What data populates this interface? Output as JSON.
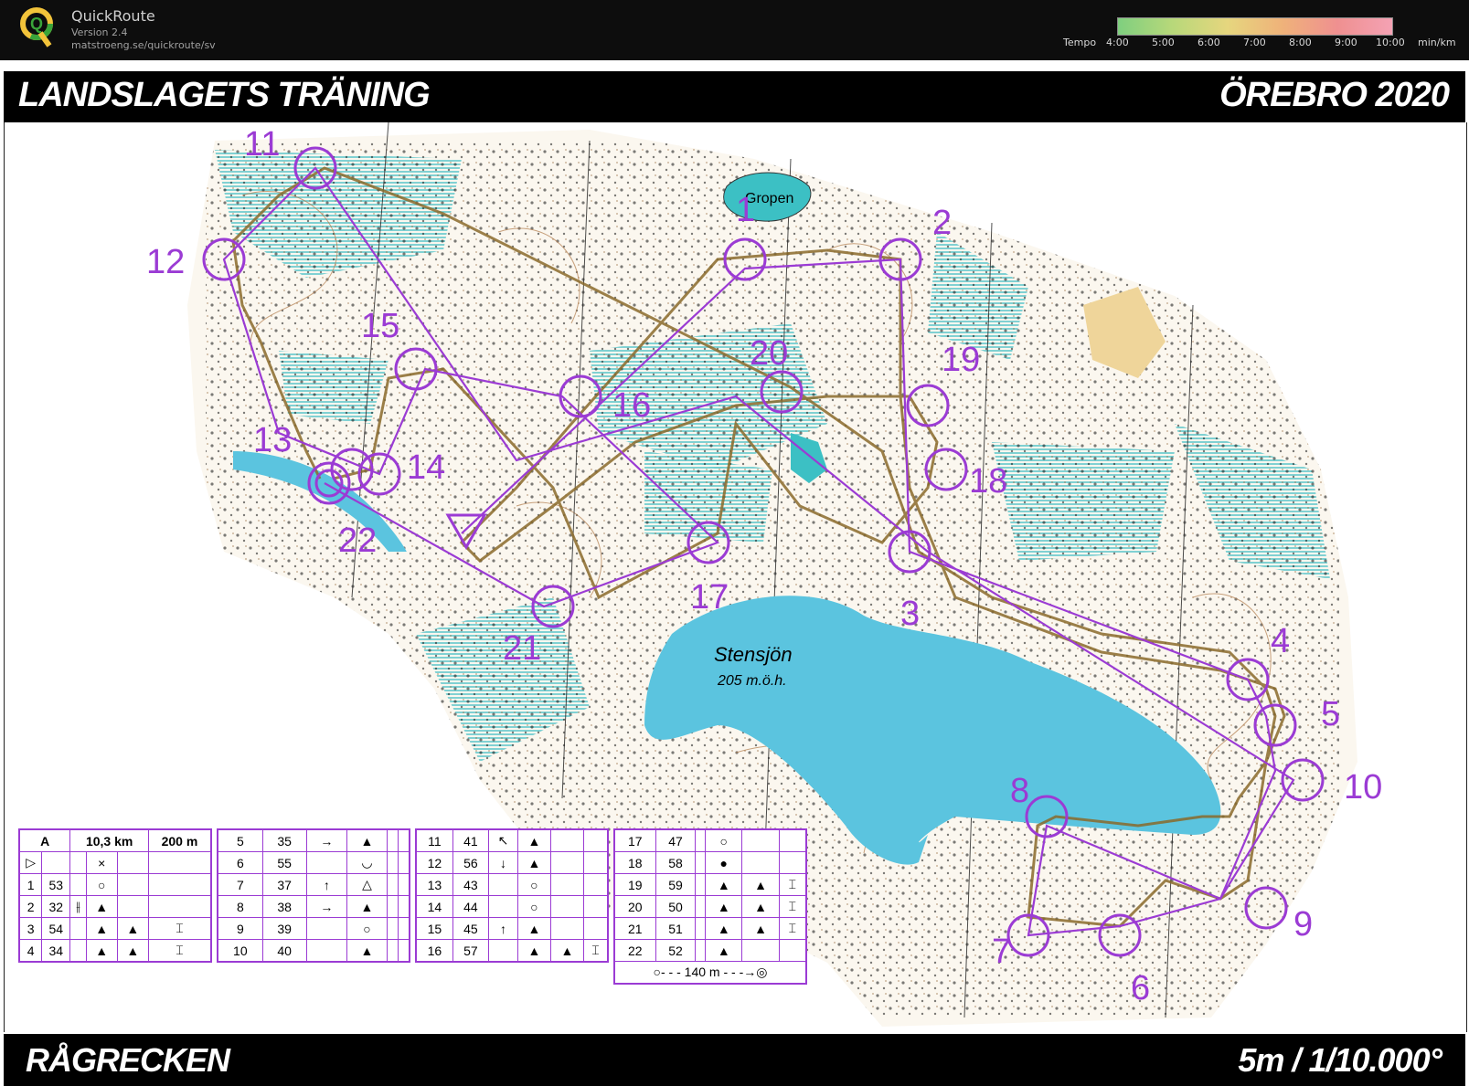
{
  "app": {
    "name": "QuickRoute",
    "version": "Version 2.4",
    "url": "matstroeng.se/quickroute/sv"
  },
  "tempo_legend": {
    "label": "Tempo",
    "ticks": [
      "4:00",
      "5:00",
      "6:00",
      "7:00",
      "8:00",
      "9:00",
      "10:00"
    ],
    "unit": "min/km"
  },
  "header": {
    "left": "LANDSLAGETS TRÄNING",
    "right": "ÖREBRO 2020"
  },
  "footer": {
    "left": "RÅGRECKEN",
    "right": "5m / 1/10.000°"
  },
  "map": {
    "lake_name": "Stensjön",
    "lake_altitude": "205 m.ö.h.",
    "pond_name": "Gropen",
    "control_labels": [
      "1",
      "2",
      "3",
      "4",
      "5",
      "6",
      "7",
      "8",
      "9",
      "10",
      "11",
      "12",
      "13",
      "14",
      "15",
      "16",
      "17",
      "18",
      "19",
      "20",
      "21",
      "22"
    ]
  },
  "descriptions": {
    "course": "A",
    "length": "10,3 km",
    "climb": "200 m",
    "finish_distance": "140 m",
    "rows": [
      [
        "1",
        "53"
      ],
      [
        "2",
        "32"
      ],
      [
        "3",
        "54"
      ],
      [
        "4",
        "34"
      ],
      [
        "5",
        "35"
      ],
      [
        "6",
        "55"
      ],
      [
        "7",
        "37"
      ],
      [
        "8",
        "38"
      ],
      [
        "9",
        "39"
      ],
      [
        "10",
        "40"
      ],
      [
        "11",
        "41"
      ],
      [
        "12",
        "56"
      ],
      [
        "13",
        "43"
      ],
      [
        "14",
        "44"
      ],
      [
        "15",
        "45"
      ],
      [
        "16",
        "57"
      ],
      [
        "17",
        "47"
      ],
      [
        "18",
        "58"
      ],
      [
        "19",
        "59"
      ],
      [
        "20",
        "50"
      ],
      [
        "21",
        "51"
      ],
      [
        "22",
        "52"
      ]
    ]
  },
  "colors": {
    "course": "#9b3bd4",
    "water": "#5bc4df",
    "vegetation": "#a9e0e4",
    "contour": "#b07a4a",
    "route": "#7b5a2a"
  }
}
